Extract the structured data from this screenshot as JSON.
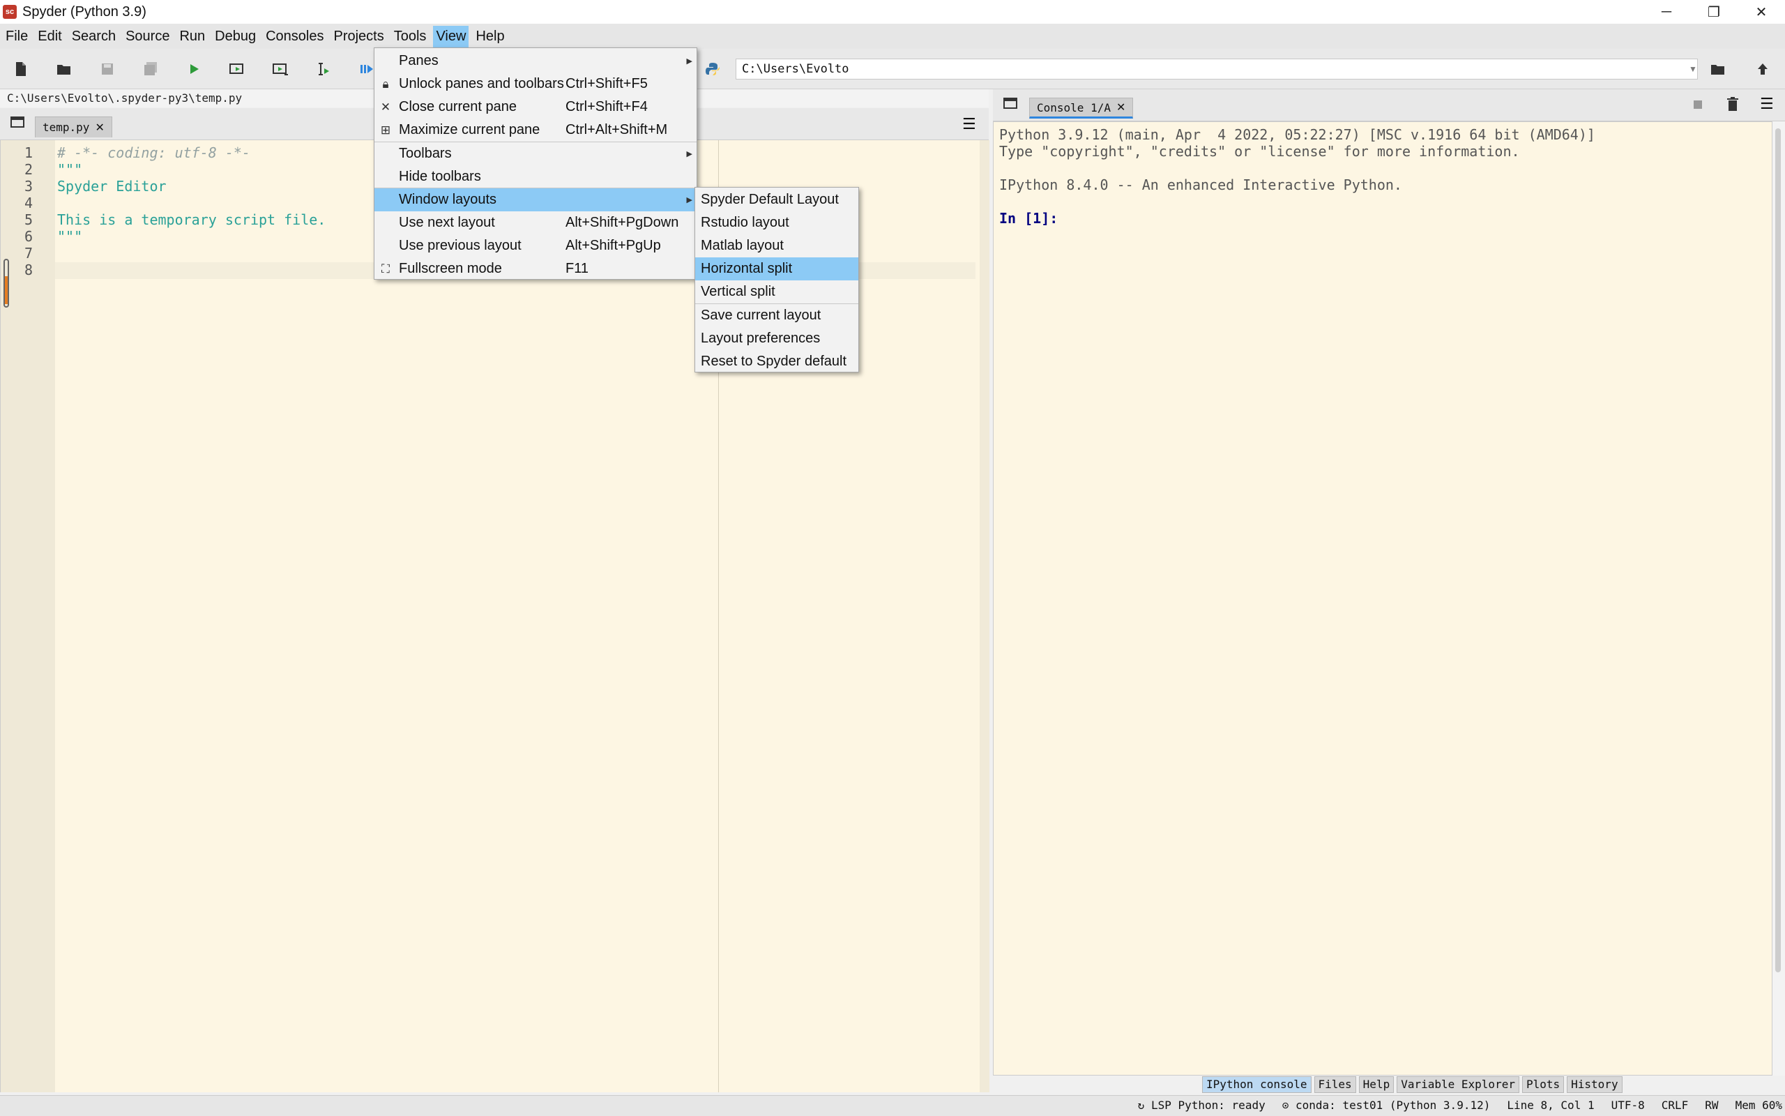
{
  "window": {
    "title": "Spyder (Python 3.9)",
    "icon_text": "sc"
  },
  "menubar": [
    "File",
    "Edit",
    "Search",
    "Source",
    "Run",
    "Debug",
    "Consoles",
    "Projects",
    "Tools",
    "View",
    "Help"
  ],
  "toolbar": {
    "path": "C:\\Users\\Evolto"
  },
  "editor": {
    "path": "C:\\Users\\Evolto\\.spyder-py3\\temp.py",
    "tab": "temp.py",
    "lines": [
      "1",
      "2",
      "3",
      "4",
      "5",
      "6",
      "7",
      "8"
    ],
    "code": [
      "# -*- coding: utf-8 -*-",
      "\"\"\"",
      "Spyder Editor",
      "",
      "This is a temporary script file.",
      "\"\"\"",
      "",
      ""
    ]
  },
  "console": {
    "tab": "Console 1/A",
    "lines": [
      "Python 3.9.12 (main, Apr  4 2022, 05:22:27) [MSC v.1916 64 bit (AMD64)]",
      "Type \"copyright\", \"credits\" or \"license\" for more information.",
      "IPython 8.4.0 -- An enhanced Interactive Python.",
      "In [1]:"
    ]
  },
  "bottom_tabs": [
    "IPython console",
    "Files",
    "Help",
    "Variable Explorer",
    "Plots",
    "History"
  ],
  "status": [
    "LSP Python: ready",
    "conda: test01 (Python 3.9.12)",
    "Line 8, Col 1",
    "UTF-8",
    "CRLF",
    "RW",
    "Mem 60%"
  ],
  "view_menu": {
    "items": [
      {
        "label": "Panes",
        "shortcut": ""
      },
      {
        "label": "Unlock panes and toolbars",
        "shortcut": "Ctrl+Shift+F5"
      },
      {
        "label": "Close current pane",
        "shortcut": "Ctrl+Shift+F4"
      },
      {
        "label": "Maximize current pane",
        "shortcut": "Ctrl+Alt+Shift+M"
      },
      {
        "label": "Toolbars",
        "shortcut": ""
      },
      {
        "label": "Hide toolbars",
        "shortcut": ""
      },
      {
        "label": "Window layouts",
        "shortcut": ""
      },
      {
        "label": "Use next layout",
        "shortcut": "Alt+Shift+PgDown"
      },
      {
        "label": "Use previous layout",
        "shortcut": "Alt+Shift+PgUp"
      },
      {
        "label": "Fullscreen mode",
        "shortcut": "F11"
      }
    ]
  },
  "layouts_menu": {
    "items": [
      "Spyder Default Layout",
      "Rstudio layout",
      "Matlab layout",
      "Horizontal split",
      "Vertical split",
      "Save current layout",
      "Layout preferences",
      "Reset to Spyder default"
    ]
  },
  "colors": {
    "accent": "#8ccaf5",
    "editor_bg": "#fdf6e3",
    "comment": "#93a1a1",
    "string": "#2aa198",
    "prompt": "#000080"
  }
}
